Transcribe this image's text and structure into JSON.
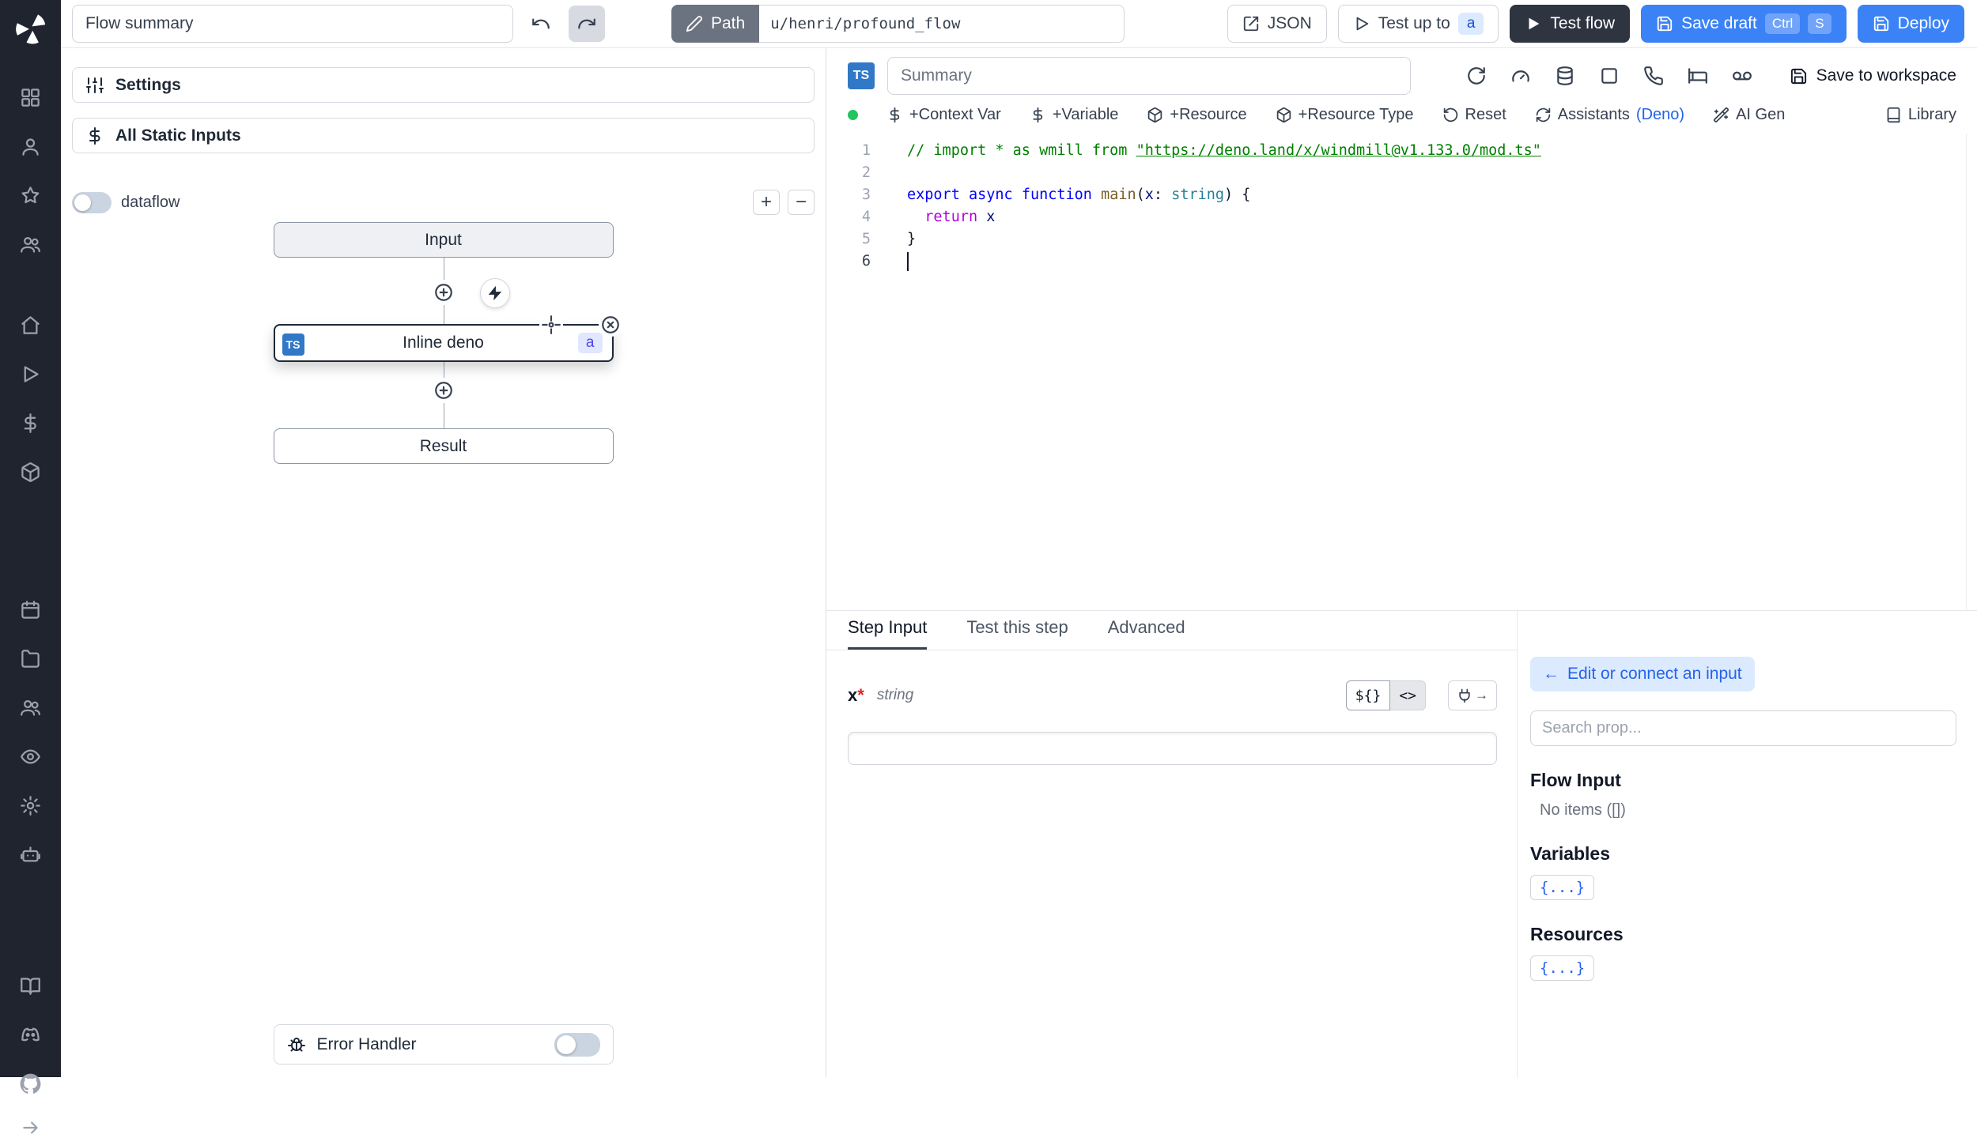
{
  "colors": {
    "sidebar_bg": "#1f242f",
    "primary_blue": "#3b82f6",
    "dark_button": "#2e3440",
    "ts_badge_blue": "#3178c6",
    "status_green": "#22c55e"
  },
  "sidebar": {
    "groups": [
      {
        "icons": [
          "grid-icon",
          "user-icon",
          "star-icon",
          "users-icon"
        ]
      },
      {
        "icons": [
          "home-icon",
          "play-icon",
          "dollar-icon",
          "cube-icon"
        ]
      },
      {
        "icons": [
          "calendar-icon",
          "folder-icon",
          "users-icon",
          "eye-icon",
          "gear-icon",
          "robot-icon"
        ]
      },
      {
        "icons": [
          "book-icon",
          "discord-icon",
          "github-icon"
        ]
      }
    ],
    "collapse_icon": "arrow-right-icon"
  },
  "topbar": {
    "flow_summary_value": "Flow summary",
    "path_label": "Path",
    "path_value": "u/henri/profound_flow",
    "json_button": "JSON",
    "test_up_to_label": "Test up to",
    "test_up_to_badge": "a",
    "test_flow_label": "Test flow",
    "save_draft_label": "Save draft",
    "save_draft_keys": [
      "Ctrl",
      "S"
    ],
    "deploy_label": "Deploy"
  },
  "flow_panel": {
    "settings_label": "Settings",
    "static_inputs_label": "All Static Inputs",
    "dataflow_label": "dataflow",
    "zoom_in_label": "+",
    "zoom_out_label": "−",
    "input_node_label": "Input",
    "step_node_label": "Inline deno",
    "step_node_lang_badge": "TS",
    "step_node_id_badge": "a",
    "result_node_label": "Result",
    "error_handler_label": "Error Handler"
  },
  "editor": {
    "lang_badge": "TS",
    "summary_placeholder": "Summary",
    "head_icons": [
      "refresh-icon",
      "gauge-icon",
      "database-icon",
      "checkbox-icon",
      "phone-icon",
      "bed-icon",
      "voicemail-icon"
    ],
    "save_to_workspace_label": "Save to workspace",
    "toolbar": {
      "context_var_label": "+Context Var",
      "variable_label": "+Variable",
      "resource_label": "+Resource",
      "resource_type_label": "+Resource Type",
      "reset_label": "Reset",
      "assistants_label": "Assistants",
      "assistants_lang": "(Deno)",
      "ai_gen_label": "AI Gen",
      "library_label": "Library"
    },
    "code_lines": [
      {
        "n": "1",
        "tokens": [
          {
            "t": "// import * as wmill from ",
            "c": "comment"
          },
          {
            "t": "\"https://deno.land/x/windmill@v1.133.0/mod.ts\"",
            "c": "comment-link"
          }
        ]
      },
      {
        "n": "2",
        "tokens": []
      },
      {
        "n": "3",
        "tokens": [
          {
            "t": "export",
            "c": "keyword"
          },
          {
            "t": " ",
            "c": "plain"
          },
          {
            "t": "async",
            "c": "keyword"
          },
          {
            "t": " ",
            "c": "plain"
          },
          {
            "t": "function",
            "c": "keyword"
          },
          {
            "t": " ",
            "c": "plain"
          },
          {
            "t": "main",
            "c": "func"
          },
          {
            "t": "(",
            "c": "plain"
          },
          {
            "t": "x",
            "c": "param"
          },
          {
            "t": ": ",
            "c": "plain"
          },
          {
            "t": "string",
            "c": "type"
          },
          {
            "t": ") {",
            "c": "plain"
          }
        ]
      },
      {
        "n": "4",
        "tokens": [
          {
            "t": "  ",
            "c": "plain"
          },
          {
            "t": "return",
            "c": "control"
          },
          {
            "t": " ",
            "c": "plain"
          },
          {
            "t": "x",
            "c": "param"
          }
        ]
      },
      {
        "n": "5",
        "tokens": [
          {
            "t": "}",
            "c": "plain"
          }
        ]
      },
      {
        "n": "6",
        "tokens": [],
        "cursor": true
      }
    ]
  },
  "bottom": {
    "tabs": [
      "Step Input",
      "Test this step",
      "Advanced"
    ],
    "active_tab": "Step Input",
    "arg": {
      "name": "x",
      "required_mark": "*",
      "type": "string"
    },
    "arg_buttons": {
      "expr": "${}",
      "code": "<>"
    },
    "connect": {
      "edit_button_arrow": "←",
      "edit_button_label": "Edit or connect an input",
      "search_placeholder": "Search prop...",
      "flow_input_heading": "Flow Input",
      "flow_input_empty": "No items ([])",
      "variables_heading": "Variables",
      "variables_button": "{...}",
      "resources_heading": "Resources",
      "resources_button": "{...}"
    }
  }
}
